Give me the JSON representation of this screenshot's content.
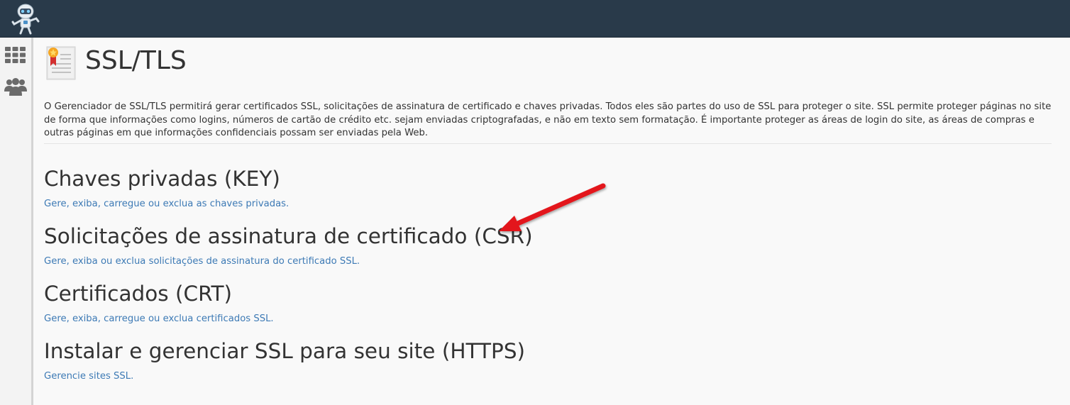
{
  "header": {
    "logo_icon": "robot-mascot-logo",
    "background": "#293a4a"
  },
  "sidebar": {
    "items": [
      {
        "icon": "apps-grid-icon"
      },
      {
        "icon": "users-group-icon"
      }
    ]
  },
  "page": {
    "title": "SSL/TLS",
    "title_icon": "certificate-icon",
    "description": "O Gerenciador de SSL/TLS permitirá gerar certificados SSL, solicitações de assinatura de certificado e chaves privadas. Todos eles são partes do uso de SSL para proteger o site. SSL permite proteger páginas no site de forma que informações como logins, números de cartão de crédito etc. sejam enviadas criptografadas, e não em texto sem formatação. É importante proteger as áreas de login do site, as áreas de compras e outras páginas em que informações confidenciais possam ser enviadas pela Web."
  },
  "sections": [
    {
      "title": "Chaves privadas (KEY)",
      "link": "Gere, exiba, carregue ou exclua as chaves privadas."
    },
    {
      "title": "Solicitações de assinatura de certificado (CSR)",
      "link": "Gere, exiba ou exclua solicitações de assinatura do certificado SSL."
    },
    {
      "title": "Certificados (CRT)",
      "link": "Gere, exiba, carregue ou exclua certificados SSL."
    },
    {
      "title": "Instalar e gerenciar SSL para seu site (HTTPS)",
      "link": "Gerencie sites SSL."
    }
  ],
  "annotation": {
    "icon": "red-arrow-pointer",
    "color": "#e3151a"
  },
  "colors": {
    "link": "#3d7ab5",
    "text": "#333333",
    "background": "#f9f9f9"
  }
}
